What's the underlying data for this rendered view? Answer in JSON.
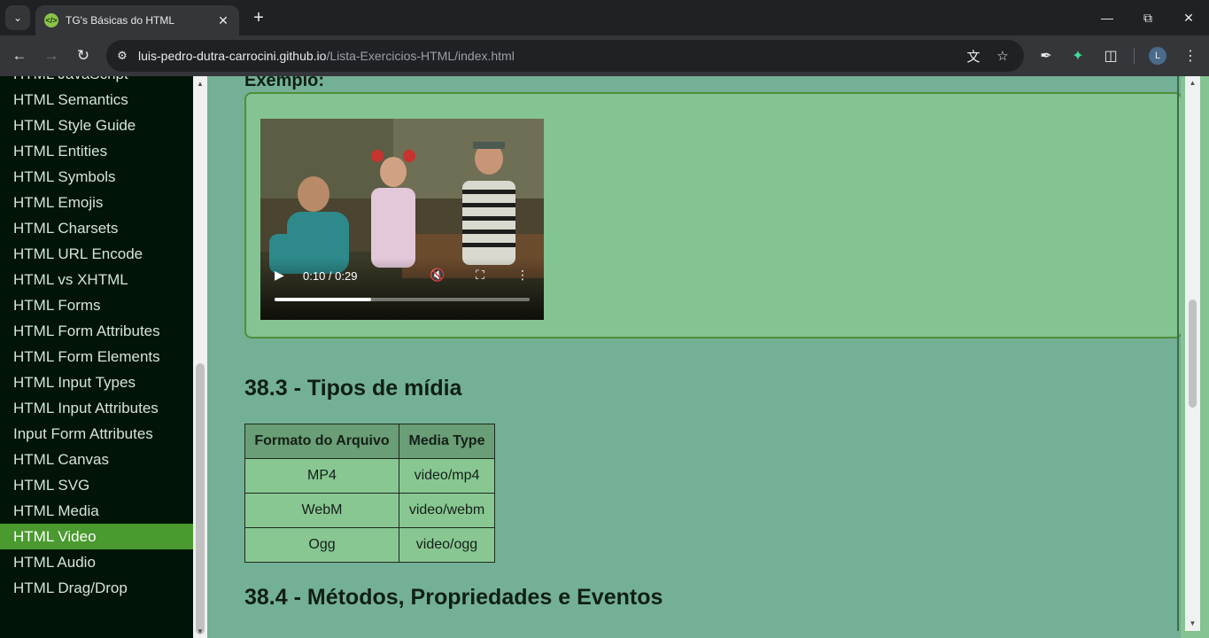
{
  "browser": {
    "tab_title": "TG's Básicas do HTML",
    "favicon_text": "</>",
    "url_host": "luis-pedro-dutra-carrocini.github.io",
    "url_path": "/Lista-Exercicios-HTML/index.html",
    "profile_initial": "L"
  },
  "sidebar": {
    "items": [
      {
        "label": "HTML JavaScript"
      },
      {
        "label": "HTML Semantics"
      },
      {
        "label": "HTML Style Guide"
      },
      {
        "label": "HTML Entities"
      },
      {
        "label": "HTML Symbols"
      },
      {
        "label": "HTML Emojis"
      },
      {
        "label": "HTML Charsets"
      },
      {
        "label": "HTML URL Encode"
      },
      {
        "label": "HTML vs XHTML"
      },
      {
        "label": "HTML Forms"
      },
      {
        "label": "HTML Form Attributes"
      },
      {
        "label": "HTML Form Elements"
      },
      {
        "label": "HTML Input Types"
      },
      {
        "label": "HTML Input Attributes"
      },
      {
        "label": "Input Form Attributes"
      },
      {
        "label": "HTML Canvas"
      },
      {
        "label": "HTML SVG"
      },
      {
        "label": "HTML Media"
      },
      {
        "label": "HTML Video",
        "active": true
      },
      {
        "label": "HTML Audio"
      },
      {
        "label": "HTML Drag/Drop"
      }
    ]
  },
  "content": {
    "example_label": "Exemplo:",
    "video": {
      "time": "0:10 / 0:29",
      "progress": 0.38,
      "muted": true
    },
    "section_media_types": "38.3 - Tipos de mídia",
    "table": {
      "headers": [
        "Formato do Arquivo",
        "Media Type"
      ],
      "rows": [
        [
          "MP4",
          "video/mp4"
        ],
        [
          "WebM",
          "video/webm"
        ],
        [
          "Ogg",
          "video/ogg"
        ]
      ]
    },
    "section_methods": "38.4 - Métodos, Propriedades e Eventos"
  }
}
